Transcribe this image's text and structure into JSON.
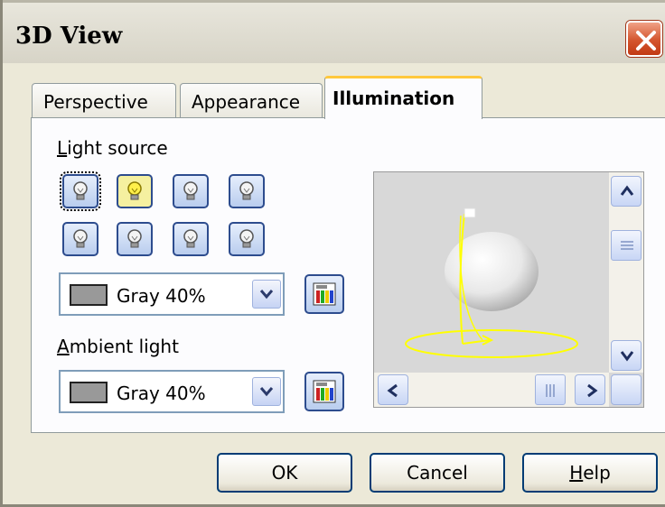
{
  "window": {
    "title": "3D View"
  },
  "tabs": [
    {
      "label": "Perspective",
      "active": false
    },
    {
      "label": "Appearance",
      "active": false
    },
    {
      "label": "Illumination",
      "active": true
    }
  ],
  "illumination": {
    "light_source_label": "Light source",
    "light_sources": [
      {
        "icon": "light-bulb-icon",
        "state": "off",
        "focused": true
      },
      {
        "icon": "light-bulb-icon",
        "state": "on",
        "focused": false
      },
      {
        "icon": "light-bulb-icon",
        "state": "off",
        "focused": false
      },
      {
        "icon": "light-bulb-icon",
        "state": "off",
        "focused": false
      },
      {
        "icon": "light-bulb-icon",
        "state": "off",
        "focused": false
      },
      {
        "icon": "light-bulb-icon",
        "state": "off",
        "focused": false
      },
      {
        "icon": "light-bulb-icon",
        "state": "off",
        "focused": false
      },
      {
        "icon": "light-bulb-icon",
        "state": "off",
        "focused": false
      }
    ],
    "light_color": {
      "value": "Gray 40%",
      "swatch": "#999999"
    },
    "ambient_light_label": "Ambient light",
    "ambient_color": {
      "value": "Gray 40%",
      "swatch": "#999999"
    }
  },
  "buttons": {
    "ok": "OK",
    "cancel": "Cancel",
    "help": "Help"
  },
  "colors": {
    "active_tab_accent": "#ffc83c",
    "close_button": "#d4552e",
    "light_path": "#ffff00"
  }
}
